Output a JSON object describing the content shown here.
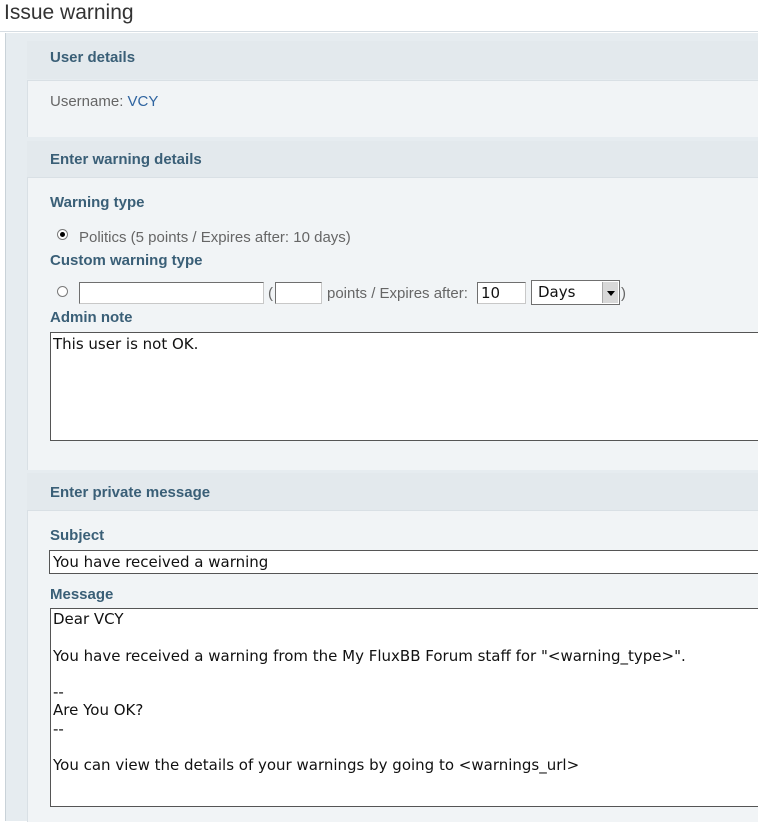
{
  "page": {
    "title": "Issue warning"
  },
  "user_details": {
    "heading": "User details",
    "username_label": "Username: ",
    "username_value": "VCY"
  },
  "warning_details": {
    "heading": "Enter warning details",
    "warning_type_label": "Warning type",
    "preset_option": "Politics (5 points / Expires after: 10 days)",
    "preset_selected": true,
    "custom_label": "Custom warning type",
    "custom_type_value": "",
    "open_paren": "(",
    "custom_points_value": "",
    "points_expires_text": "points / Expires after:",
    "expires_value": "10",
    "expires_unit": "Days",
    "close_paren": ")",
    "admin_note_label": "Admin note",
    "admin_note_value": "This user is not OK."
  },
  "private_message": {
    "heading": "Enter private message",
    "subject_label": "Subject",
    "subject_value": "You have received a warning",
    "message_label": "Message",
    "message_value": "Dear VCY\n\nYou have received a warning from the My FluxBB Forum staff for \"<warning_type>\".\n\n--\nAre You OK?\n--\n\nYou can view the details of your warnings by going to <warnings_url>"
  },
  "colors": {
    "heading": "#3a5f77",
    "link": "#2f64a0",
    "panel_bg": "#e6ecf0",
    "box_bg": "#f1f4f6"
  }
}
